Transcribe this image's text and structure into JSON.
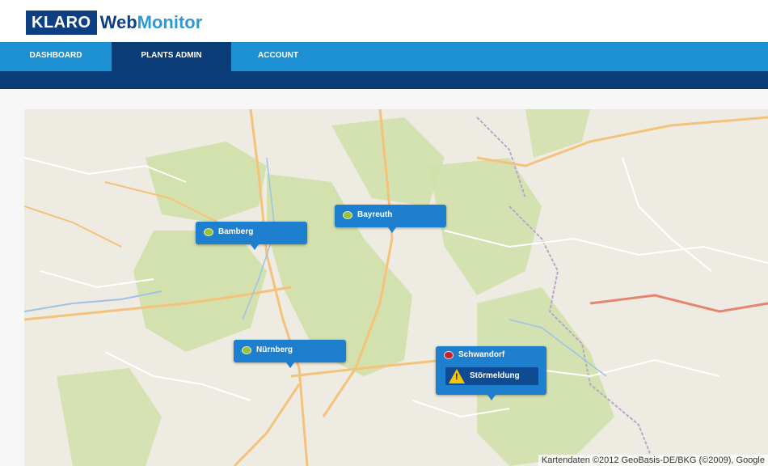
{
  "brand": {
    "klaro": "KLARO",
    "web": "Web",
    "monitor": "Monitor"
  },
  "nav": {
    "tabs": [
      {
        "label": "DASHBOARD",
        "active": false
      },
      {
        "label": "PLANTS ADMIN",
        "active": true
      },
      {
        "label": "ACCOUNT",
        "active": false
      }
    ]
  },
  "map": {
    "markers": [
      {
        "label": "Bamberg",
        "status": "ok"
      },
      {
        "label": "Bayreuth",
        "status": "ok"
      },
      {
        "label": "Nürnberg",
        "status": "ok"
      },
      {
        "label": "Schwandorf",
        "status": "error",
        "alert": "Störmeldung"
      }
    ],
    "attribution": "Kartendaten ©2012 GeoBasis-DE/BKG (©2009), Google"
  },
  "colors": {
    "nav_bar": "#1d8fd3",
    "nav_active": "#0a3c78",
    "brand_dark": "#0d3f82",
    "brand_light": "#2a9ad8",
    "marker": "#1f7fcf",
    "status_ok": "#9ac13a",
    "status_error": "#c7202c",
    "warning": "#f6c600"
  }
}
